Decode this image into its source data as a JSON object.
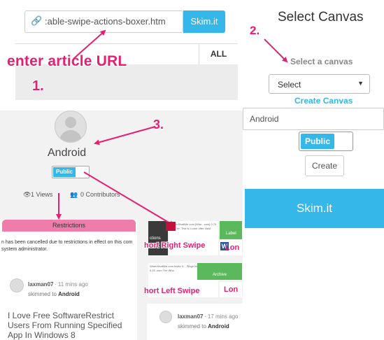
{
  "panel1": {
    "url_value": ":able-swipe-actions-boxer.htm",
    "skim_button": "Skim.it",
    "tab_all": "ALL",
    "annotation_label": "enter article URL",
    "step": "1."
  },
  "panel2": {
    "title": "Select Canvas",
    "step": "2.",
    "select_label": "Select a canvas",
    "select_value": "Select",
    "create_canvas_link": "Create Canvas",
    "canvas_name_value": "Android",
    "public_toggle": "Public",
    "create_button": "Create",
    "skim_button": "Skim.it"
  },
  "panel3": {
    "step": "3.",
    "canvas_name": "Android",
    "public_toggle": "Public",
    "views": "1 Views",
    "contributors": "0 Contributors",
    "restrictions_header": "Restrictions",
    "restrictions_text": "n has been cancelled due to restrictions in effect on this com system administrator.",
    "activity1": {
      "user": "laxman07",
      "time": "· 11 mins ago",
      "action": "skimmed to",
      "canvas": "Android",
      "title": "I Love Free SoftwareRestrict Users From Running Specified App In Windows 8"
    },
    "activity2": {
      "user": "laxman07",
      "time": "· 17 mins ago",
      "action": "skimmed to",
      "canvas": "Android"
    },
    "swipe_right_label": "hort Right Swipe",
    "swipe_left_label": "hort Left Swipe",
    "thumb_actions_label": "ctions",
    "thumb_label_label": "Label",
    "thumb_archive_label": "Archive",
    "thumb_long1": "Lon",
    "thumb_long2": "Lon",
    "thumb_snippet1": "WhenShallWe.com [Whe...com] 0.73 Eon 5e. This is o.com offer Valid",
    "thumb_snippet2": "WhenShallWe.com Invite S... Singh has invited you to 5.15 .com The Who",
    "word_icon_letter": "W"
  },
  "colors": {
    "accent": "#35b7ea",
    "annotation": "#e51f74",
    "restrictions": "#f07cab",
    "green": "#5cb85c"
  }
}
